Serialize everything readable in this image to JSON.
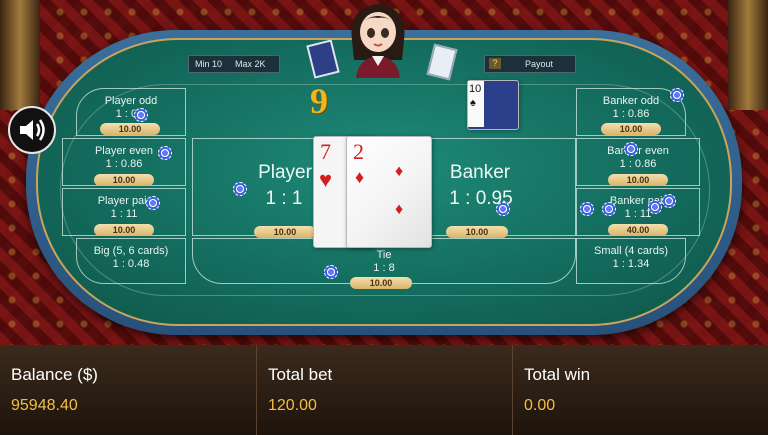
{
  "colors": {
    "felt": "#136a5c",
    "gold": "#f0c040",
    "chip": "#3b5fe0",
    "card_red": "#d21f1f"
  },
  "limits": {
    "min": "Min 10",
    "max": "Max 2K"
  },
  "payout_button": {
    "label": "Payout",
    "icon": "question-mark-icon"
  },
  "score": "9",
  "sound_icon": "speaker-icon",
  "side_bets_left": [
    {
      "title": "Player odd",
      "odds": "1 : 0.9",
      "bet": "10.00"
    },
    {
      "title": "Player even",
      "odds": "1 : 0.86",
      "bet": "10.00"
    },
    {
      "title": "Player pair",
      "odds": "1 : 11",
      "bet": "10.00"
    },
    {
      "title": "Big (5, 6 cards)",
      "odds": "1 : 0.48",
      "bet": ""
    }
  ],
  "side_bets_right": [
    {
      "title": "Banker odd",
      "odds": "1 : 0.86",
      "bet": "10.00"
    },
    {
      "title": "Banker even",
      "odds": "1 : 0.86",
      "bet": "10.00"
    },
    {
      "title": "Banker pair",
      "odds": "1 : 11",
      "bet": "40.00"
    },
    {
      "title": "Small (4 cards)",
      "odds": "1 : 1.34",
      "bet": ""
    }
  ],
  "main": {
    "player": {
      "label": "Player",
      "odds": "1 : 1",
      "bet": "10.00"
    },
    "banker": {
      "label": "Banker",
      "odds": "1 : 0.95",
      "bet": "10.00"
    },
    "tie": {
      "label": "Tie",
      "odds": "1 : 8",
      "bet": "10.00"
    }
  },
  "cards": [
    {
      "rank": "7",
      "suit": "♥"
    },
    {
      "rank": "2",
      "suit": "♦"
    }
  ],
  "deck_card": {
    "rank": "10",
    "suit": "♠"
  },
  "footer": {
    "balance": {
      "label": "Balance ($)",
      "value": "95948.40"
    },
    "total_bet": {
      "label": "Total bet",
      "value": "120.00"
    },
    "total_win": {
      "label": "Total win",
      "value": "0.00"
    }
  }
}
